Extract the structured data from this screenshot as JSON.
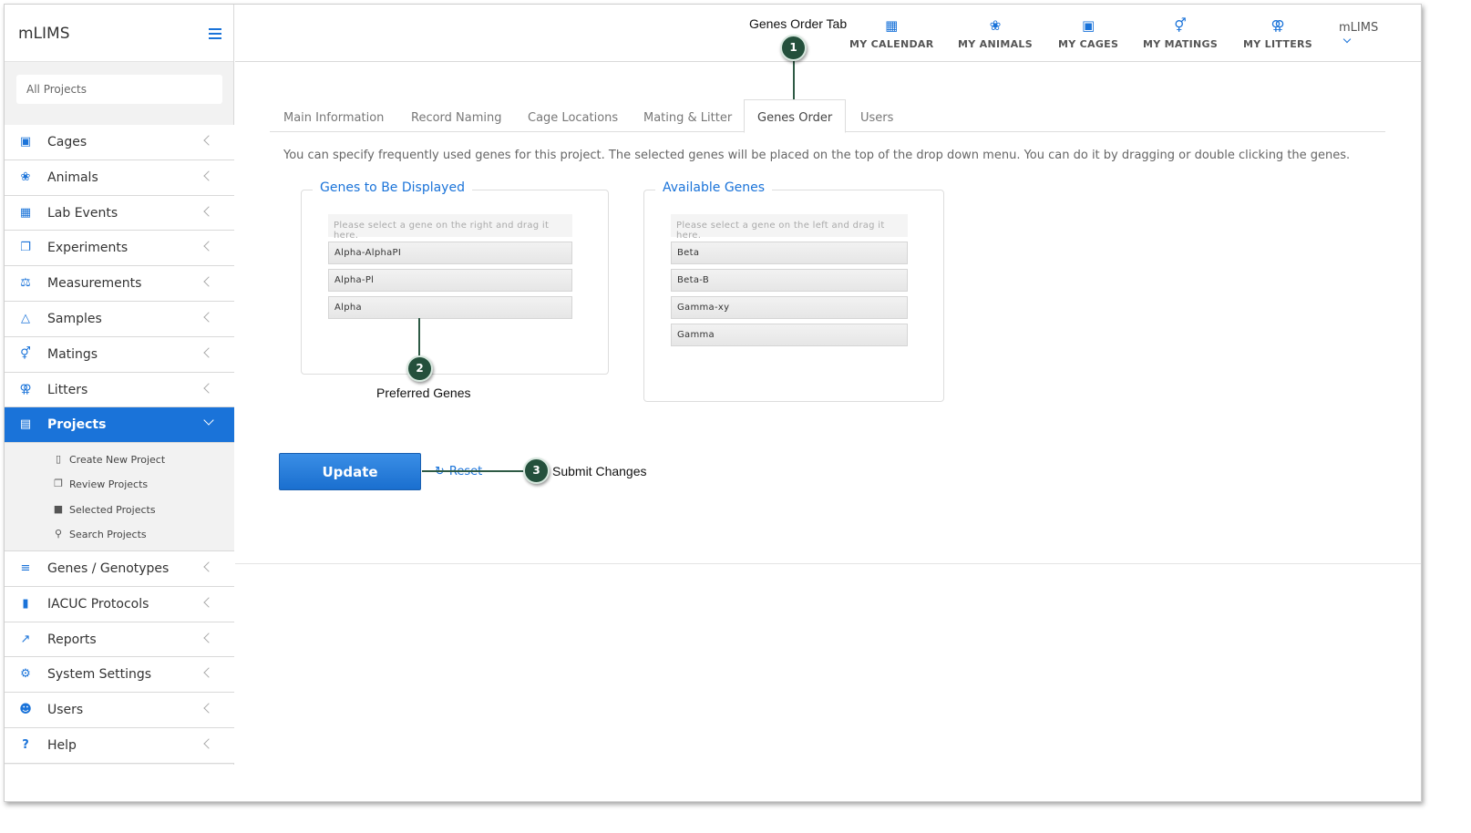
{
  "brand": {
    "title": "mLIMS"
  },
  "project_select": {
    "value": "All Projects"
  },
  "sidebar": {
    "items": [
      {
        "label": "Cages",
        "icon": "cube-icon"
      },
      {
        "label": "Animals",
        "icon": "paw-icon"
      },
      {
        "label": "Lab Events",
        "icon": "calendar-icon"
      },
      {
        "label": "Experiments",
        "icon": "copy-icon"
      },
      {
        "label": "Measurements",
        "icon": "scale-icon"
      },
      {
        "label": "Samples",
        "icon": "flask-icon"
      },
      {
        "label": "Matings",
        "icon": "mating-icon"
      },
      {
        "label": "Litters",
        "icon": "litter-icon"
      },
      {
        "label": "Projects",
        "icon": "folder-open-icon"
      }
    ],
    "sub_items": [
      {
        "label": "Create New Project",
        "icon": "file-icon"
      },
      {
        "label": "Review Projects",
        "icon": "files-icon"
      },
      {
        "label": "Selected Projects",
        "icon": "cart-icon"
      },
      {
        "label": "Search Projects",
        "icon": "search-icon"
      }
    ],
    "items_after": [
      {
        "label": "Genes / Genotypes",
        "icon": "list-icon"
      },
      {
        "label": "IACUC Protocols",
        "icon": "book-icon"
      },
      {
        "label": "Reports",
        "icon": "line-chart-icon"
      },
      {
        "label": "System Settings",
        "icon": "gear-icon"
      },
      {
        "label": "Users",
        "icon": "users-icon"
      },
      {
        "label": "Help",
        "icon": "question-icon"
      }
    ]
  },
  "topbar": {
    "links": [
      {
        "label": "MY CALENDAR",
        "icon": "calendar-icon"
      },
      {
        "label": "MY ANIMALS",
        "icon": "paw-icon"
      },
      {
        "label": "MY CAGES",
        "icon": "cube-icon"
      },
      {
        "label": "MY MATINGS",
        "icon": "mating-icon"
      },
      {
        "label": "MY LITTERS",
        "icon": "litter-icon"
      }
    ],
    "user": "mLIMS"
  },
  "tabs": [
    "Main Information",
    "Record Naming",
    "Cage Locations",
    "Mating & Litter",
    "Genes Order",
    "Users"
  ],
  "active_tab": "Genes Order",
  "description": "You can specify frequently used genes for this project. The selected genes will be placed on the top of the drop down menu. You can do it by dragging or double clicking the genes.",
  "displayed_genes": {
    "title": "Genes to Be Displayed",
    "placeholder": "Please select a gene on the right and drag it here.",
    "items": [
      "Alpha-AlphaPI",
      "Alpha-Pl",
      "Alpha"
    ]
  },
  "available_genes": {
    "title": "Available Genes",
    "placeholder": "Please select a gene on the left and drag it here.",
    "items": [
      "Beta",
      "Beta-B",
      "Gamma-xy",
      "Gamma"
    ]
  },
  "actions": {
    "update": "Update",
    "reset": "Reset"
  },
  "callouts": [
    {
      "number": "1",
      "text": "Genes Order Tab"
    },
    {
      "number": "2",
      "text": "Preferred Genes"
    },
    {
      "number": "3",
      "text": "Submit Changes"
    }
  ],
  "colors": {
    "accent": "#1a73d9",
    "callout": "#24503c"
  }
}
